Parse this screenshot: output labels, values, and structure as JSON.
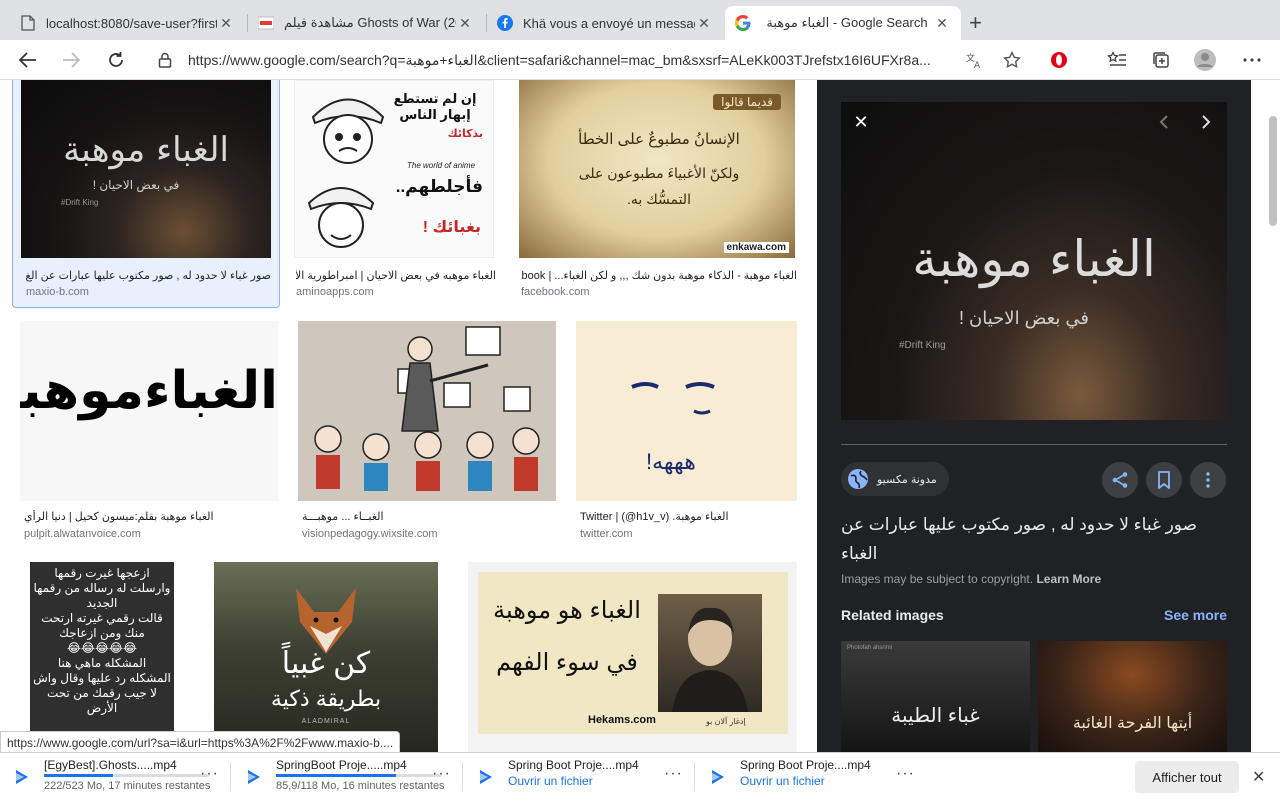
{
  "tabs": [
    {
      "title": "localhost:8080/save-user?first",
      "icon": "document-icon"
    },
    {
      "title": "مشاهدة فيلم Ghosts of War (2020)",
      "icon": "egybest-favicon"
    },
    {
      "title": "Khä vous a envoyé un message",
      "icon": "facebook-icon"
    },
    {
      "title": "الغباء موهبة - Google Search",
      "icon": "google-icon"
    }
  ],
  "address": {
    "url": "https://www.google.com/search?q=الغباء+موهبة&client=safari&channel=mac_bm&sxsrf=ALeKk003TJrefstx16I6UFXr8a..."
  },
  "results": [
    {
      "title": "صور غباء لا حدود له , صور مكتوب عليها عبارات عن الغ...",
      "source": "maxio-b.com",
      "thumb_text": "الغباء موهبة",
      "thumb_sub": "في بعض الاحيان !",
      "thumb_tag": "#Drift King"
    },
    {
      "title": "الغباء موهبه في بعض الاحيان | امبراطورية الأ...",
      "source": "aminoapps.com",
      "thumb_text": "إن لم تستطع إبهار الناس",
      "thumb_sub": "فأجلطهم..",
      "thumb_tag": "بغبائك !",
      "thumb_extra": "The world of anime",
      "thumb_extra2": "بذكائك"
    },
    {
      "title": "الغباء موهبة - الذكاء موهبة بدون شك ,,, و لكن الغباء... | ebook...",
      "source": "facebook.com",
      "thumb_text": "الإنسانُ مطبوعٌ على الخطأ",
      "thumb_sub": "ولكنّ الأغبياءَ مطبوعون على التمسُّك به.",
      "thumb_tag": "قديما قالوا",
      "thumb_extra": "enkawa.com"
    },
    {
      "title": "الغباء موهبة بقلم:ميسون كحيل | دنيا الرأي",
      "source": "pulpit.alwatanvoice.com",
      "thumb_text": "الغباءموهبة"
    },
    {
      "title": "الغبــاء ... موهبـــة",
      "source": "visionpedagogy.wixsite.com"
    },
    {
      "title": "الغباء موهبة. (h1v_v@) | Twitter",
      "source": "twitter.com",
      "thumb_text": "هههه!"
    },
    {
      "title": "",
      "source": "",
      "thumb_lines": [
        "ازعجها غيرت رقمها",
        "وارسلت له رساله من رقمها",
        "الجديد",
        "قالت رقمي غيرته ارتحت",
        "منك ومن ازعاجك",
        "😂😂😂😂😂",
        "المشكله ماهي هنا",
        "المشكله رد عليها وقال واش",
        "لا جيب رقمك من تحت",
        "الأرض"
      ]
    },
    {
      "title": "",
      "source": "",
      "thumb_text": "كن غبياً",
      "thumb_sub": "بطريقة ذكية",
      "thumb_tag": "ALADMIRAL"
    },
    {
      "title": "",
      "source": "",
      "thumb_text": "الغباء هو موهبة",
      "thumb_sub": "في سوء الفهم",
      "thumb_tag": "Hekams.com",
      "thumb_extra": "إدغار آلان بو"
    }
  ],
  "panel": {
    "image_text": "الغباء موهبة",
    "image_sub": "في بعض الاحيان !",
    "image_tag": "#Drift King",
    "site_name": "مدونة مكسيو",
    "title": "صور غباء لا حدود له , صور مكتوب عليها عبارات عن الغباء",
    "copyright": "Images may be subject to copyright.",
    "learn_more": "Learn More",
    "related_label": "Related images",
    "see_more": "See more",
    "related": [
      {
        "text": "غباء الطيبة",
        "tag": "Photofah ahsrimi"
      },
      {
        "text": "أيتها الفرحة الغائبة",
        "tag": ""
      }
    ]
  },
  "status_url": "https://www.google.com/url?sa=i&url=https%3A%2F%2Fwww.maxio-b....",
  "downloads": [
    {
      "name": "[EgyBest].Ghosts.....mp4",
      "sub": "222/523 Mo, 17 minutes restantes",
      "progress": 0.42,
      "link": false
    },
    {
      "name": "SpringBoot Proje.....mp4",
      "sub": "85,9/118 Mo, 16 minutes restantes",
      "progress": 0.73,
      "link": false
    },
    {
      "name": "Spring Boot Proje....mp4",
      "sub": "Ouvrir un fichier",
      "progress": 1,
      "link": true
    },
    {
      "name": "Spring Boot Proje....mp4",
      "sub": "Ouvrir un fichier",
      "progress": 1,
      "link": true
    }
  ],
  "downloads_show_all": "Afficher tout",
  "colors": {
    "accent": "#1a73e8",
    "panel_bg": "#202124",
    "link_blue": "#8ab4f8",
    "opera_red": "#e0001b"
  }
}
